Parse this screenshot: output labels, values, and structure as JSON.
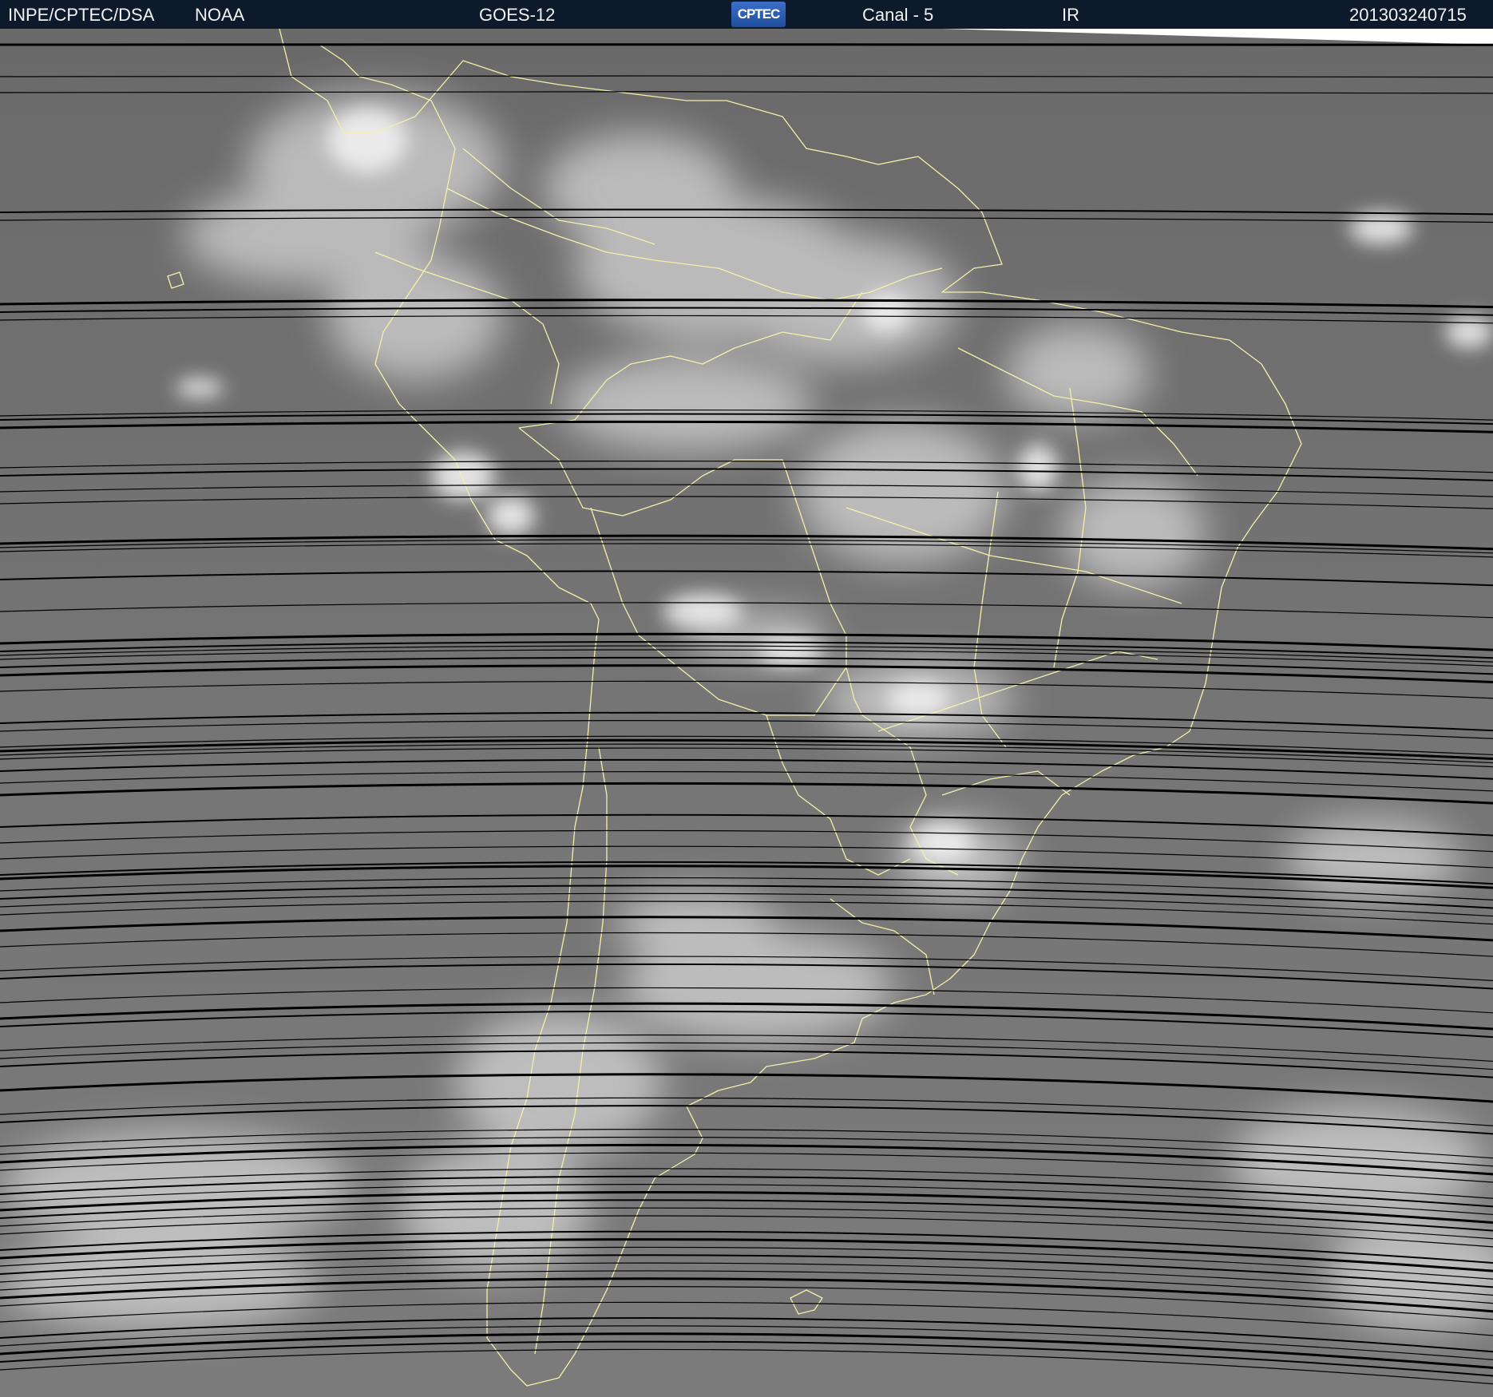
{
  "header": {
    "agency": "INPE/CPTEC/DSA",
    "provider": "NOAA",
    "satellite": "GOES-12",
    "logo_text": "CPTEC",
    "channel": "Canal - 5",
    "band": "IR",
    "timestamp": "201303240715"
  },
  "map": {
    "imagery": "infrared satellite image, grayscale",
    "region": "South America",
    "border_color": "#f3f0a8",
    "scanline_color": "#000000"
  }
}
